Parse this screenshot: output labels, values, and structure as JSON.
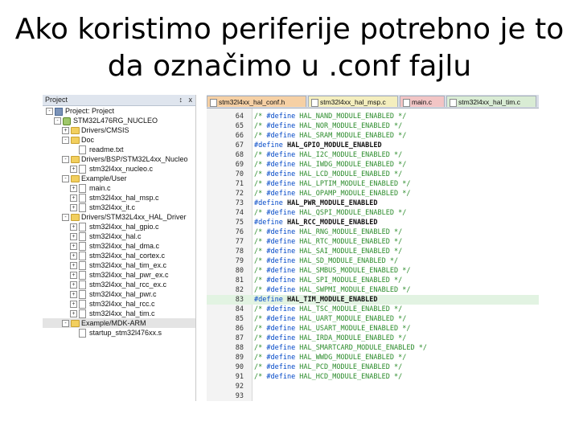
{
  "title": {
    "line1": "Ako koristimo periferije potrebno je to",
    "line2": "da označimo u .conf fajlu"
  },
  "project_pane": {
    "header": "Project",
    "pin": "↕",
    "close": "x",
    "tree": [
      {
        "label": "Project: Project",
        "level": 0,
        "icon": "project-icon",
        "expander": "-"
      },
      {
        "label": "STM32L476RG_NUCLEO",
        "level": 1,
        "icon": "target-icon",
        "expander": "-"
      },
      {
        "label": "Drivers/CMSIS",
        "level": 2,
        "icon": "folder-icon",
        "expander": "+"
      },
      {
        "label": "Doc",
        "level": 2,
        "icon": "folder-icon",
        "expander": "-"
      },
      {
        "label": "readme.txt",
        "level": 3,
        "icon": "file-icon",
        "expander": ""
      },
      {
        "label": "Drivers/BSP/STM32L4xx_Nucleo",
        "level": 2,
        "icon": "folder-icon",
        "expander": "-"
      },
      {
        "label": "stm32l4xx_nucleo.c",
        "level": 3,
        "icon": "file-icon",
        "expander": "+"
      },
      {
        "label": "Example/User",
        "level": 2,
        "icon": "folder-icon",
        "expander": "-"
      },
      {
        "label": "main.c",
        "level": 3,
        "icon": "file-icon",
        "expander": "+"
      },
      {
        "label": "stm32l4xx_hal_msp.c",
        "level": 3,
        "icon": "file-icon",
        "expander": "+"
      },
      {
        "label": "stm32l4xx_it.c",
        "level": 3,
        "icon": "file-icon",
        "expander": "+"
      },
      {
        "label": "Drivers/STM32L4xx_HAL_Driver",
        "level": 2,
        "icon": "folder-icon",
        "expander": "-"
      },
      {
        "label": "stm32l4xx_hal_gpio.c",
        "level": 3,
        "icon": "file-icon",
        "expander": "+"
      },
      {
        "label": "stm32l4xx_hal.c",
        "level": 3,
        "icon": "file-icon",
        "expander": "+"
      },
      {
        "label": "stm32l4xx_hal_dma.c",
        "level": 3,
        "icon": "file-icon",
        "expander": "+"
      },
      {
        "label": "stm32l4xx_hal_cortex.c",
        "level": 3,
        "icon": "file-icon",
        "expander": "+"
      },
      {
        "label": "stm32l4xx_hal_tim_ex.c",
        "level": 3,
        "icon": "file-icon",
        "expander": "+"
      },
      {
        "label": "stm32l4xx_hal_pwr_ex.c",
        "level": 3,
        "icon": "file-icon",
        "expander": "+"
      },
      {
        "label": "stm32l4xx_hal_rcc_ex.c",
        "level": 3,
        "icon": "file-icon",
        "expander": "+"
      },
      {
        "label": "stm32l4xx_hal_pwr.c",
        "level": 3,
        "icon": "file-icon",
        "expander": "+"
      },
      {
        "label": "stm32l4xx_hal_rcc.c",
        "level": 3,
        "icon": "file-icon",
        "expander": "+"
      },
      {
        "label": "stm32l4xx_hal_tim.c",
        "level": 3,
        "icon": "file-icon",
        "expander": "+"
      },
      {
        "label": "Example/MDK-ARM",
        "level": 2,
        "icon": "folder-icon",
        "expander": "-",
        "selected": true
      },
      {
        "label": "startup_stm32l476xx.s",
        "level": 3,
        "icon": "file-icon",
        "expander": ""
      }
    ]
  },
  "editor": {
    "tabs": [
      {
        "label": "stm32l4xx_hal_conf.h"
      },
      {
        "label": "stm32l4xx_hal_msp.c"
      },
      {
        "label": "main.c"
      },
      {
        "label": "stm32l4xx_hal_tim.c"
      }
    ],
    "lines": [
      {
        "num": "64",
        "parts": [
          [
            "cmt",
            "/* "
          ],
          [
            "dir",
            "#define"
          ],
          [
            "cmt",
            " HAL_NAND_MODULE_ENABLED */"
          ]
        ]
      },
      {
        "num": "65",
        "parts": [
          [
            "cmt",
            "/* "
          ],
          [
            "dir",
            "#define"
          ],
          [
            "cmt",
            " HAL_NOR_MODULE_ENABLED */"
          ]
        ]
      },
      {
        "num": "66",
        "parts": [
          [
            "cmt",
            "/* "
          ],
          [
            "dir",
            "#define"
          ],
          [
            "cmt",
            " HAL_SRAM_MODULE_ENABLED */"
          ]
        ]
      },
      {
        "num": "67",
        "parts": [
          [
            "dir",
            "#define"
          ],
          [
            "mac",
            " HAL_GPIO_MODULE_ENABLED"
          ]
        ]
      },
      {
        "num": "68",
        "parts": [
          [
            "cmt",
            "/* "
          ],
          [
            "dir",
            "#define"
          ],
          [
            "cmt",
            " HAL_I2C_MODULE_ENABLED */"
          ]
        ]
      },
      {
        "num": "69",
        "parts": [
          [
            "cmt",
            "/* "
          ],
          [
            "dir",
            "#define"
          ],
          [
            "cmt",
            " HAL_IWDG_MODULE_ENABLED */"
          ]
        ]
      },
      {
        "num": "70",
        "parts": [
          [
            "cmt",
            "/* "
          ],
          [
            "dir",
            "#define"
          ],
          [
            "cmt",
            " HAL_LCD_MODULE_ENABLED */"
          ]
        ]
      },
      {
        "num": "71",
        "parts": [
          [
            "cmt",
            "/* "
          ],
          [
            "dir",
            "#define"
          ],
          [
            "cmt",
            " HAL_LPTIM_MODULE_ENABLED */"
          ]
        ]
      },
      {
        "num": "72",
        "parts": [
          [
            "cmt",
            "/* "
          ],
          [
            "dir",
            "#define"
          ],
          [
            "cmt",
            " HAL_OPAMP_MODULE_ENABLED */"
          ]
        ]
      },
      {
        "num": "73",
        "parts": [
          [
            "dir",
            "#define"
          ],
          [
            "mac",
            " HAL_PWR_MODULE_ENABLED"
          ]
        ]
      },
      {
        "num": "74",
        "parts": [
          [
            "cmt",
            "/* "
          ],
          [
            "dir",
            "#define"
          ],
          [
            "cmt",
            " HAL_QSPI_MODULE_ENABLED */"
          ]
        ]
      },
      {
        "num": "75",
        "parts": [
          [
            "dir",
            "#define"
          ],
          [
            "mac",
            " HAL_RCC_MODULE_ENABLED"
          ]
        ]
      },
      {
        "num": "76",
        "parts": [
          [
            "cmt",
            "/* "
          ],
          [
            "dir",
            "#define"
          ],
          [
            "cmt",
            " HAL_RNG_MODULE_ENABLED */"
          ]
        ]
      },
      {
        "num": "77",
        "parts": [
          [
            "cmt",
            "/* "
          ],
          [
            "dir",
            "#define"
          ],
          [
            "cmt",
            " HAL_RTC_MODULE_ENABLED */"
          ]
        ]
      },
      {
        "num": "78",
        "parts": [
          [
            "cmt",
            "/* "
          ],
          [
            "dir",
            "#define"
          ],
          [
            "cmt",
            " HAL_SAI_MODULE_ENABLED */"
          ]
        ]
      },
      {
        "num": "79",
        "parts": [
          [
            "cmt",
            "/* "
          ],
          [
            "dir",
            "#define"
          ],
          [
            "cmt",
            " HAL_SD_MODULE_ENABLED */"
          ]
        ]
      },
      {
        "num": "80",
        "parts": [
          [
            "cmt",
            "/* "
          ],
          [
            "dir",
            "#define"
          ],
          [
            "cmt",
            " HAL_SMBUS_MODULE_ENABLED */"
          ]
        ]
      },
      {
        "num": "81",
        "parts": [
          [
            "cmt",
            "/* "
          ],
          [
            "dir",
            "#define"
          ],
          [
            "cmt",
            " HAL_SPI_MODULE_ENABLED */"
          ]
        ]
      },
      {
        "num": "82",
        "parts": [
          [
            "cmt",
            "/* "
          ],
          [
            "dir",
            "#define"
          ],
          [
            "cmt",
            " HAL_SWPMI_MODULE_ENABLED */"
          ]
        ]
      },
      {
        "num": "83",
        "parts": [
          [
            "dir",
            "#define"
          ],
          [
            "mac",
            " HAL_TIM_MODULE_ENABLED"
          ]
        ],
        "highlight": true
      },
      {
        "num": "84",
        "parts": [
          [
            "cmt",
            "/* "
          ],
          [
            "dir",
            "#define"
          ],
          [
            "cmt",
            " HAL_TSC_MODULE_ENABLED */"
          ]
        ]
      },
      {
        "num": "85",
        "parts": [
          [
            "cmt",
            "/* "
          ],
          [
            "dir",
            "#define"
          ],
          [
            "cmt",
            " HAL_UART_MODULE_ENABLED */"
          ]
        ]
      },
      {
        "num": "86",
        "parts": [
          [
            "cmt",
            "/* "
          ],
          [
            "dir",
            "#define"
          ],
          [
            "cmt",
            " HAL_USART_MODULE_ENABLED */"
          ]
        ]
      },
      {
        "num": "87",
        "parts": [
          [
            "cmt",
            "/* "
          ],
          [
            "dir",
            "#define"
          ],
          [
            "cmt",
            " HAL_IRDA_MODULE_ENABLED */"
          ]
        ]
      },
      {
        "num": "88",
        "parts": [
          [
            "cmt",
            "/* "
          ],
          [
            "dir",
            "#define"
          ],
          [
            "cmt",
            " HAL_SMARTCARD_MODULE_ENABLED */"
          ]
        ]
      },
      {
        "num": "89",
        "parts": [
          [
            "cmt",
            "/* "
          ],
          [
            "dir",
            "#define"
          ],
          [
            "cmt",
            " HAL_WWDG_MODULE_ENABLED */"
          ]
        ]
      },
      {
        "num": "90",
        "parts": [
          [
            "cmt",
            "/* "
          ],
          [
            "dir",
            "#define"
          ],
          [
            "cmt",
            " HAL_PCD_MODULE_ENABLED */"
          ]
        ]
      },
      {
        "num": "91",
        "parts": [
          [
            "cmt",
            "/* "
          ],
          [
            "dir",
            "#define"
          ],
          [
            "cmt",
            " HAL_HCD_MODULE_ENABLED */"
          ]
        ]
      },
      {
        "num": "92",
        "parts": []
      },
      {
        "num": "93",
        "parts": []
      }
    ]
  }
}
